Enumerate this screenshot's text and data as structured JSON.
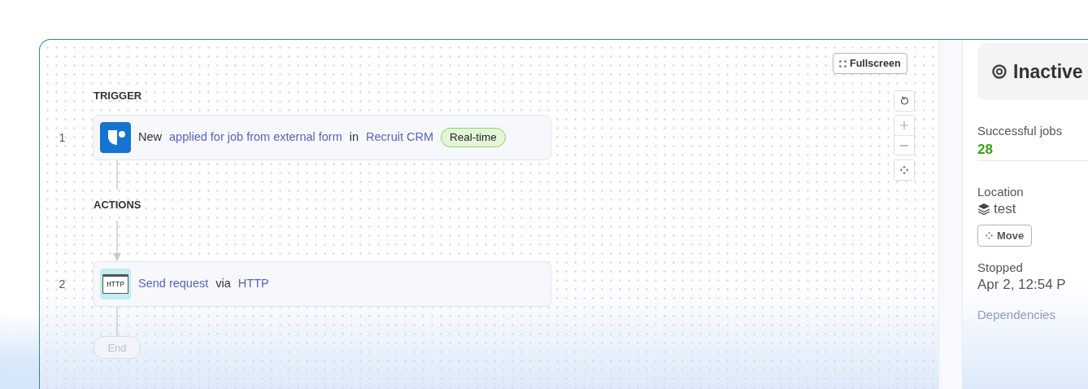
{
  "canvas": {
    "fullscreen_button": "Fullscreen",
    "flow": [
      {
        "kind": "label",
        "text": "TRIGGER"
      },
      {
        "kind": "step",
        "number": "1",
        "parts": [
          {
            "kind": "text",
            "text": "New"
          },
          {
            "kind": "link",
            "text": "applied for job from external form"
          },
          {
            "kind": "text",
            "text": "in"
          },
          {
            "kind": "link",
            "text": "Recruit CRM"
          }
        ],
        "badge": "Real-time"
      },
      {
        "kind": "line",
        "arrow": false
      },
      {
        "kind": "label",
        "text": "ACTIONS"
      },
      {
        "kind": "line",
        "arrow": true
      },
      {
        "kind": "step",
        "number": "2",
        "icon_text": "HTTP",
        "parts": [
          {
            "kind": "link",
            "text": "Send request"
          },
          {
            "kind": "text",
            "text": "via"
          },
          {
            "kind": "link",
            "text": "HTTP"
          }
        ]
      },
      {
        "kind": "line",
        "arrow": false
      },
      {
        "kind": "end",
        "text": "End"
      }
    ]
  },
  "panel": {
    "status": "Inactive",
    "fields": [
      {
        "kind": "stat",
        "label": "Successful jobs",
        "value": "28"
      },
      {
        "kind": "divider"
      },
      {
        "kind": "location",
        "label": "Location",
        "value": "test",
        "button": "Move"
      },
      {
        "kind": "plain",
        "label": "Stopped",
        "value": "Apr 2, 12:54 P"
      },
      {
        "kind": "faded",
        "label": "Dependencies"
      }
    ]
  }
}
